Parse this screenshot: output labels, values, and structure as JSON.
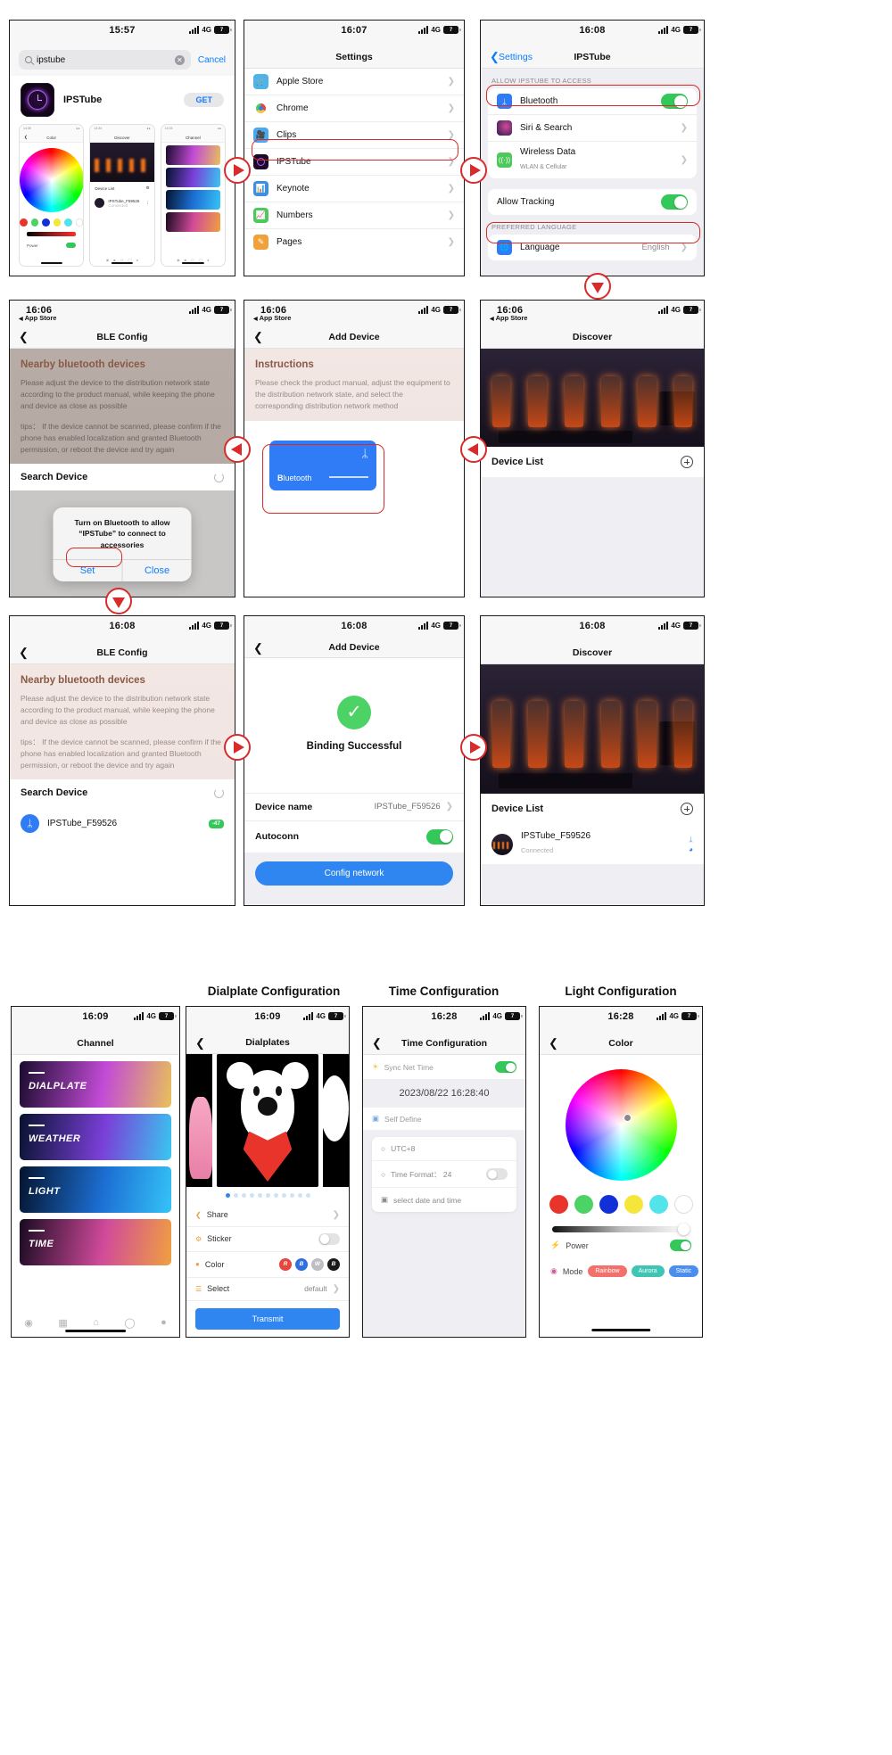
{
  "panels": {
    "p1": {
      "name": "app-store-search",
      "time": "15:57",
      "network": "4G",
      "battery": "7",
      "search_value": "ipstube",
      "cancel_label": "Cancel",
      "app_name": "IPSTube",
      "get_label": "GET",
      "shot_titles": [
        "Color",
        "Discover",
        "Channel"
      ],
      "shot_times": [
        "14:35",
        "14:34",
        "14:33"
      ]
    },
    "p2": {
      "name": "ios-settings-app-list",
      "time": "16:07",
      "network": "4G",
      "battery": "7",
      "title": "Settings",
      "rows": [
        {
          "label": "Apple Store",
          "icon": "apple-store-icon",
          "color": "#4fb3e8"
        },
        {
          "label": "Chrome",
          "icon": "chrome-icon",
          "color": "#ffffff"
        },
        {
          "label": "Clips",
          "icon": "clips-icon",
          "color": "#4aa8f0"
        },
        {
          "label": "IPSTube",
          "icon": "ipstube-icon",
          "color": "#1c0a28"
        },
        {
          "label": "Keynote",
          "icon": "keynote-icon",
          "color": "#3d8fe0"
        },
        {
          "label": "Numbers",
          "icon": "numbers-icon",
          "color": "#4cc95a"
        },
        {
          "label": "Pages",
          "icon": "pages-icon",
          "color": "#f0a13c"
        }
      ]
    },
    "p3": {
      "name": "ipstube-app-permissions",
      "time": "16:08",
      "network": "4G",
      "battery": "7",
      "back_label": "Settings",
      "title": "IPSTube",
      "section_allow": "ALLOW IPSTUBE TO ACCESS",
      "rows": [
        {
          "label": "Bluetooth",
          "sub": "",
          "icon": "bluetooth-icon",
          "color": "#2f7cf6"
        },
        {
          "label": "Siri & Search",
          "sub": "",
          "icon": "siri-icon",
          "color": "#1a1a2e"
        },
        {
          "label": "Wireless Data",
          "sub": "WLAN & Cellular",
          "icon": "wireless-data-icon",
          "color": "#4cc95a"
        }
      ],
      "tracking_label": "Allow Tracking",
      "tracking_on": true,
      "section_language": "PREFERRED LANGUAGE",
      "language_label": "Language",
      "language_value": "English"
    },
    "p4": {
      "name": "ble-config-alert",
      "time": "16:06",
      "back_app": "App Store",
      "network": "4G",
      "battery": "7",
      "title": "BLE Config",
      "heading": "Nearby bluetooth devices",
      "para1": "Please adjust the device to the distribution network state according to the product manual, while keeping the phone and device as close as possible",
      "para2": "tips： If the device cannot be scanned, please confirm if the phone has enabled localization and granted Bluetooth permission, or reboot the device and try again",
      "search_label": "Search Device",
      "alert_msg": "Turn on Bluetooth to allow “IPSTube” to connect to accessories",
      "alert_set": "Set",
      "alert_close": "Close"
    },
    "p5": {
      "name": "add-device-instructions",
      "time": "16:06",
      "back_app": "App Store",
      "network": "4G",
      "battery": "7",
      "title": "Add Device",
      "heading": "Instructions",
      "para": "Please check the product manual, adjust the equipment to the distribution network state, and select the corresponding distribution network method",
      "card_label_b": "B",
      "card_label_rest": "luetooth"
    },
    "p6": {
      "name": "discover-empty",
      "time": "16:06",
      "back_app": "App Store",
      "network": "4G",
      "battery": "7",
      "title": "Discover",
      "device_list_label": "Device List"
    },
    "p7": {
      "name": "ble-config-scanning",
      "time": "16:08",
      "network": "4G",
      "battery": "7",
      "title": "BLE Config",
      "heading": "Nearby bluetooth devices",
      "para1": "Please adjust the device to the distribution network state according to the product manual, while keeping the phone and device as close as possible",
      "para2": "tips： If the device cannot be scanned, please confirm if the phone has enabled localization and granted Bluetooth permission, or reboot the device and try again",
      "search_label": "Search Device",
      "device_name": "IPSTube_F59526",
      "rssi": "-47"
    },
    "p8": {
      "name": "binding-successful",
      "time": "16:08",
      "network": "4G",
      "battery": "7",
      "title": "Add Device",
      "status": "Binding Successful",
      "device_name_key": "Device name",
      "device_name_val": "IPSTube_F59526",
      "autoconn_key": "Autoconn",
      "autoconn_on": true,
      "config_btn": "Config network"
    },
    "p9": {
      "name": "discover-connected",
      "time": "16:08",
      "network": "4G",
      "battery": "7",
      "title": "Discover",
      "device_list_label": "Device List",
      "device_name": "IPSTube_F59526",
      "device_status": "Connected"
    },
    "b1": {
      "name": "channel-list",
      "time": "16:09",
      "network": "4G",
      "battery": "7",
      "title": "Channel",
      "cards": [
        {
          "label": "DIALPLATE",
          "c1": "#1a0b2e",
          "c2": "#c24bd6",
          "c3": "#e8c15a"
        },
        {
          "label": "WEATHER",
          "c1": "#06122e",
          "c2": "#7a3fd8",
          "c3": "#39c7f0"
        },
        {
          "label": "LIGHT",
          "c1": "#04142e",
          "c2": "#1c6fd4",
          "c3": "#35c3f7"
        },
        {
          "label": "TIME",
          "c1": "#180a20",
          "c2": "#d04a9a",
          "c3": "#f0a040"
        }
      ],
      "tabs": [
        "compass-icon",
        "grid-icon",
        "home-icon",
        "chat-icon",
        "profile-icon"
      ]
    },
    "b2": {
      "section_label": "Dialplate Configuration",
      "name": "dialplates",
      "time": "16:09",
      "network": "4G",
      "battery": "7",
      "title": "Dialplates",
      "options": [
        {
          "key": "Share",
          "icon": "share-icon",
          "value": "",
          "type": "chevron"
        },
        {
          "key": "Sticker",
          "icon": "sticker-icon",
          "value": "",
          "type": "toggle-off"
        },
        {
          "key": "Color",
          "icon": "color-icon",
          "value": "",
          "type": "chips"
        },
        {
          "key": "Select",
          "icon": "select-icon",
          "value": "default",
          "type": "chevron"
        }
      ],
      "chips": [
        {
          "t": "R",
          "c": "#e8453c"
        },
        {
          "t": "B",
          "c": "#2f6fe0"
        },
        {
          "t": "W",
          "c": "#bdbdc2"
        },
        {
          "t": "B",
          "c": "#1a1a1a"
        }
      ],
      "transmit": "Transmit",
      "dot_count": 11,
      "dot_active": 0
    },
    "b3": {
      "section_label": "Time Configuration",
      "name": "time-configuration",
      "time": "16:28",
      "network": "4G",
      "battery": "7",
      "title": "Time Configuration",
      "sync_label": "Sync Net Time",
      "sync_on": true,
      "datetime": "2023/08/22 16:28:40",
      "self_define": "Self Define",
      "items": [
        {
          "label": "UTC+8",
          "icon": "globe-icon",
          "type": "none"
        },
        {
          "label": "Time Format： 24",
          "icon": "clock-icon",
          "type": "toggle-off"
        },
        {
          "label": "select date and time",
          "icon": "calendar-icon",
          "type": "none"
        }
      ]
    },
    "b4": {
      "section_label": "Light Configuration",
      "name": "color-configuration",
      "time": "16:28",
      "network": "4G",
      "battery": "7",
      "title": "Color",
      "swatches": [
        "#e8342a",
        "#4cd265",
        "#1230d8",
        "#f5e63c",
        "#53e3ea",
        "#ffffff"
      ],
      "power_label": "Power",
      "power_on": true,
      "mode_label": "Mode",
      "modes": [
        {
          "label": "Rainbow",
          "color": "#f4716b"
        },
        {
          "label": "Aurora",
          "color": "#3ec5b5"
        },
        {
          "label": "Static",
          "color": "#4a8ff0"
        }
      ]
    }
  },
  "accent": {
    "red": "#d92b2b",
    "blue": "#0a7cff",
    "green": "#34c759"
  }
}
